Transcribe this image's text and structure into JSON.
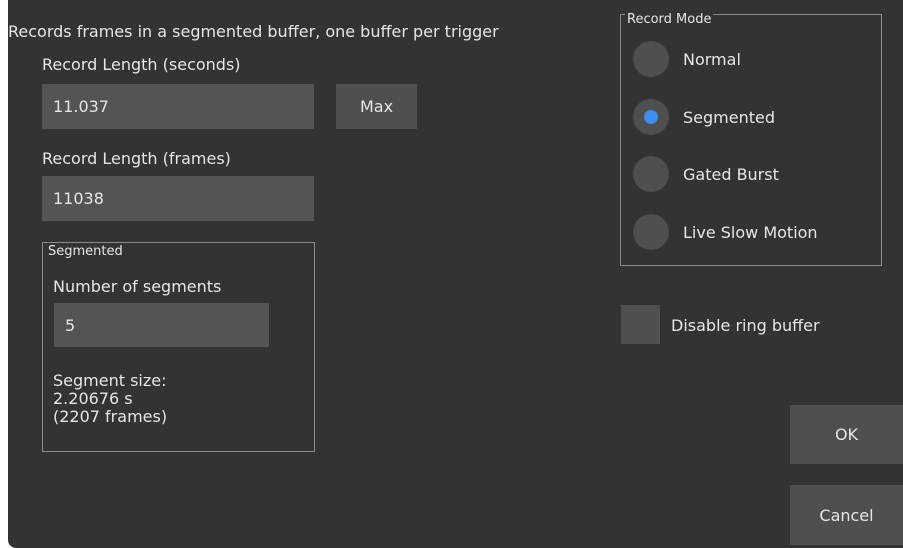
{
  "description": "Records frames in a segmented buffer, one buffer per trigger",
  "record_length_seconds": {
    "label": "Record Length (seconds)",
    "value": "11.037",
    "max_button": "Max"
  },
  "record_length_frames": {
    "label": "Record Length (frames)",
    "value": "11038"
  },
  "segmented_group": {
    "title": "Segmented",
    "num_segments_label": "Number of segments",
    "num_segments_value": "5",
    "segment_size_label": "Segment size:",
    "segment_size_seconds": "2.20676 s",
    "segment_size_frames": "(2207 frames)"
  },
  "record_mode": {
    "title": "Record Mode",
    "options": [
      {
        "label": "Normal",
        "selected": false
      },
      {
        "label": "Segmented",
        "selected": true
      },
      {
        "label": "Gated Burst",
        "selected": false
      },
      {
        "label": "Live Slow Motion",
        "selected": false
      }
    ]
  },
  "disable_ring_buffer": {
    "label": "Disable ring buffer",
    "checked": false
  },
  "buttons": {
    "ok": "OK",
    "cancel": "Cancel"
  },
  "colors": {
    "background": "#333333",
    "control": "#4f4f4f",
    "field": "#545454",
    "accent": "#3d8ef0",
    "text": "#e6e6e6"
  }
}
